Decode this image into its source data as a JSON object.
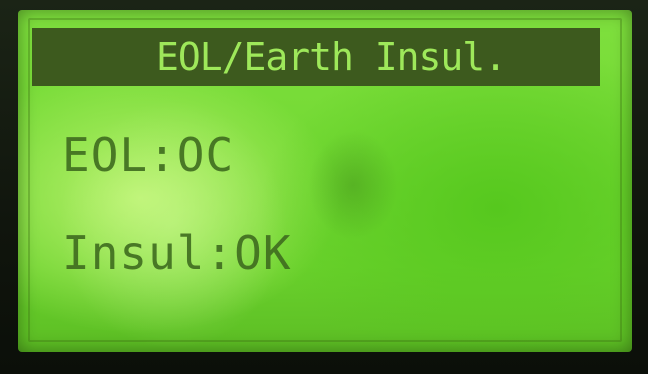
{
  "screen": {
    "title": "EOL/Earth Insul.",
    "lines": [
      "EOL:OC",
      "Insul:OK"
    ]
  },
  "colors": {
    "lcd_background": "#74d934",
    "title_bar": "#3d5a1e",
    "title_text": "#9ee85a",
    "body_text": "#3f6c1f"
  }
}
